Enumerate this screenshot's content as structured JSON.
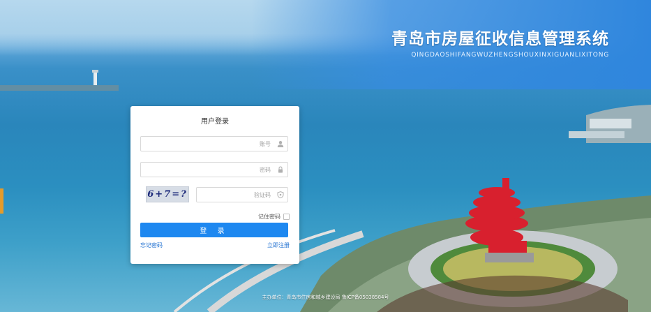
{
  "brand": {
    "title": "青岛市房屋征收信息管理系统",
    "subtitle": "QINGDAOSHIFANGWUZHENGSHOUXINXIGUANLIXITONG"
  },
  "login": {
    "title": "用户登录",
    "account_placeholder": "账号",
    "password_placeholder": "密码",
    "captcha_text": "6+7=?",
    "captcha_placeholder": "验证码",
    "remember_label": "记住密码",
    "login_button": "登 录",
    "forgot_link": "忘记密码",
    "register_link": "立即注册"
  },
  "icons": {
    "account": "user-icon",
    "password": "lock-icon",
    "captcha": "shield-icon"
  },
  "colors": {
    "primary": "#1e88f0",
    "banner": "#2f86dd",
    "link": "#1e6fd0"
  },
  "footer": {
    "text": "主办单位：青岛市住房和城乡建设局 鲁ICP备05038584号"
  }
}
